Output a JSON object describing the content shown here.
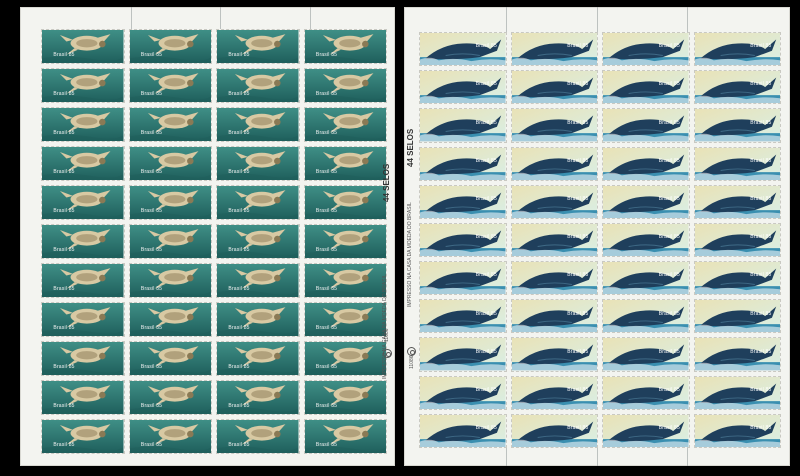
{
  "sheets": [
    {
      "id": "turtle",
      "rows": 11,
      "cols": 4,
      "stamp_value": "Brasil 85",
      "counter_text": "44 SELOS",
      "printer_text": "IMPRESSO NA CASA DA MOEDA DO BRASIL",
      "serial": "11086",
      "colors": {
        "sea": "#3f8f86",
        "sea_deep": "#1f5f5c",
        "shell": "#d8c9a3",
        "shell_dark": "#8a7a55"
      }
    },
    {
      "id": "whale",
      "rows": 11,
      "cols": 4,
      "stamp_value": "Brasil 85",
      "counter_text": "44 SELOS",
      "printer_text": "IMPRESSO NA CASA DA MOEDA DO BRASIL",
      "serial": "11086",
      "colors": {
        "sky": "#d9efe6",
        "sky_warm": "#e9e2b6",
        "sea": "#3a8fb0",
        "whale": "#1f3f5c",
        "whale_light": "#3f6a86"
      }
    }
  ]
}
